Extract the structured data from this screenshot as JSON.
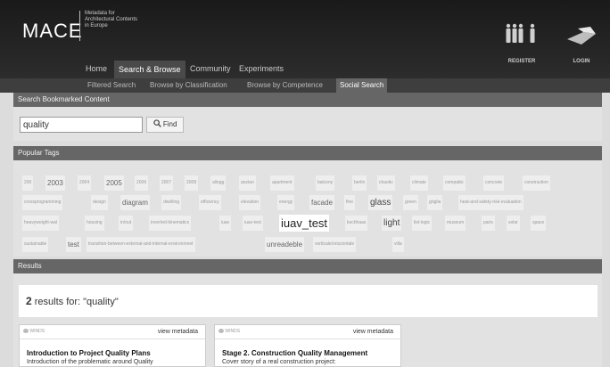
{
  "brand": {
    "logo": "MACE",
    "tagline_1": "Metadata for",
    "tagline_2": "Architectural Contents",
    "tagline_3": "in Europe"
  },
  "main_nav": [
    {
      "label": "Home"
    },
    {
      "label": "Search & Browse"
    },
    {
      "label": "Community"
    },
    {
      "label": "Experiments"
    }
  ],
  "header_actions": {
    "register": "REGISTER",
    "login": "LOGIN"
  },
  "sub_nav": [
    {
      "label": "Filtered Search"
    },
    {
      "label": "Browse by Classification"
    },
    {
      "label": "Browse by Competence"
    },
    {
      "label": "Social Search"
    }
  ],
  "search": {
    "section_title": "Search Bookmarked Content",
    "query": "quality",
    "find_label": "Find"
  },
  "popular_tags": {
    "section_title": "Popular Tags",
    "tags": [
      {
        "label": "200"
      },
      {
        "label": "2003"
      },
      {
        "label": "2004"
      },
      {
        "label": "2005"
      },
      {
        "label": "2006"
      },
      {
        "label": "2007"
      },
      {
        "label": "2008"
      },
      {
        "label": "allogg"
      },
      {
        "label": "anzian"
      },
      {
        "label": "apartment"
      },
      {
        "label": "balcony"
      },
      {
        "label": "berlin"
      },
      {
        "label": "chaotic"
      },
      {
        "label": "climate"
      },
      {
        "label": "compatto"
      },
      {
        "label": "concrete"
      },
      {
        "label": "construction"
      },
      {
        "label": "crossprogramming"
      },
      {
        "label": "design"
      },
      {
        "label": "diagram"
      },
      {
        "label": "dwelling"
      },
      {
        "label": "efficiency"
      },
      {
        "label": "elevation"
      },
      {
        "label": "energy"
      },
      {
        "label": "facade"
      },
      {
        "label": "fine"
      },
      {
        "label": "glass"
      },
      {
        "label": "green"
      },
      {
        "label": "griglia"
      },
      {
        "label": "heat-and-safety-risk-evaluation"
      },
      {
        "label": "heavyweight-wal"
      },
      {
        "label": "housing"
      },
      {
        "label": "in/out"
      },
      {
        "label": "inverted-kinematics"
      },
      {
        "label": "iuav"
      },
      {
        "label": "iuav-test"
      },
      {
        "label": "iuav_test"
      },
      {
        "label": "kochhaas"
      },
      {
        "label": "light"
      },
      {
        "label": "list-logic"
      },
      {
        "label": "museum"
      },
      {
        "label": "paris"
      },
      {
        "label": "solar"
      },
      {
        "label": "space"
      },
      {
        "label": "sustainable"
      },
      {
        "label": "test"
      },
      {
        "label": "transition-between-external-and-internal-environmnet"
      },
      {
        "label": "unreadeble"
      },
      {
        "label": "verticale/orizzontale"
      },
      {
        "label": "villa"
      }
    ]
  },
  "results": {
    "section_title": "Results",
    "count": "2",
    "count_text": "results for: \"quality\"",
    "items": [
      {
        "source": "WINDS",
        "view_label": "view metadata",
        "title": "Introduction to Project Quality Plans",
        "description": "Introduction of the problematic around Quality"
      },
      {
        "source": "WINDS",
        "view_label": "view metadata",
        "title": "Stage 2. Construction Quality Management",
        "description": "Cover story of a real construction project:"
      }
    ]
  },
  "colors": {
    "header": "#1a1a1a",
    "subnav": "#3e3e3e",
    "section_bar": "#666666",
    "panel": "#e2e2e2"
  }
}
